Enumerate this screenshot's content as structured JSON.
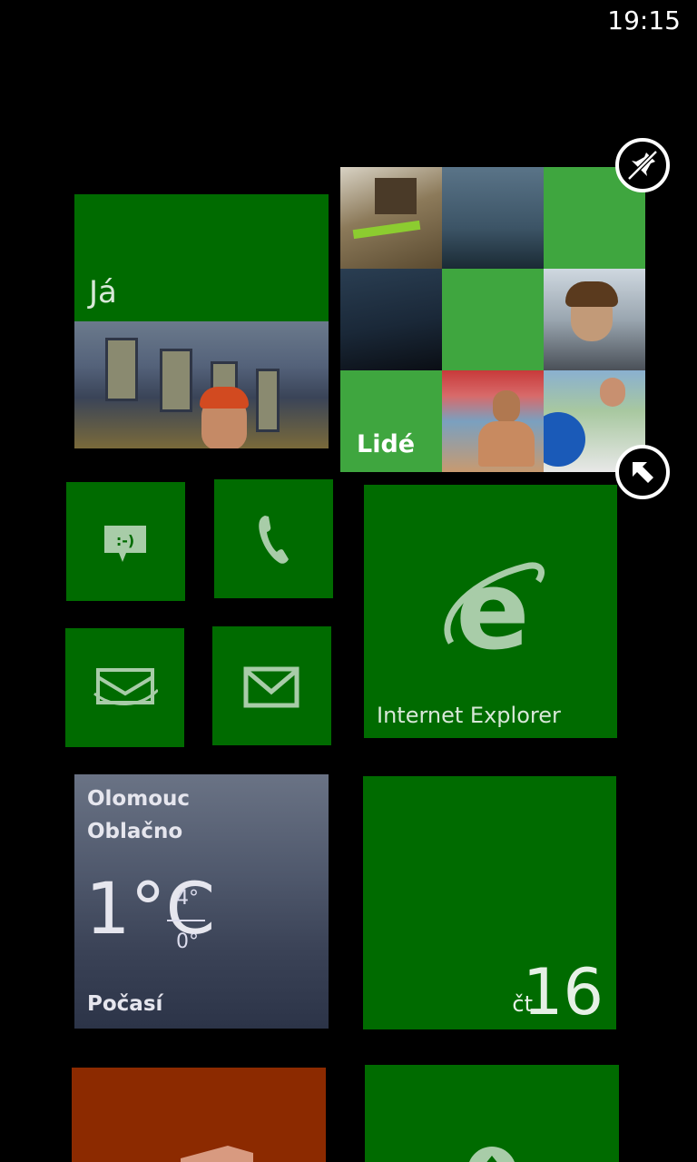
{
  "status_bar": {
    "time": "19:15"
  },
  "tiles": {
    "me": {
      "label": "Já"
    },
    "people": {
      "label": "Lidé"
    },
    "messaging": {
      "icon": "message-smiley-icon"
    },
    "phone": {
      "icon": "phone-icon"
    },
    "outlook": {
      "icon": "outlook-mail-icon"
    },
    "mail": {
      "icon": "mail-envelope-icon"
    },
    "internet_explorer": {
      "label": "Internet Explorer"
    },
    "weather": {
      "city": "Olomouc",
      "condition": "Oblačno",
      "temperature": "1°C",
      "high": "4°",
      "low": "0°",
      "label": "Počasí"
    },
    "calendar": {
      "day": "čt",
      "date": "16"
    },
    "office": {
      "icon": "office-icon"
    },
    "xbox": {
      "icon": "xbox-icon"
    }
  },
  "edit_controls": {
    "unpin_icon": "unpin-icon",
    "resize_icon": "resize-arrow-icon"
  },
  "colors": {
    "accent": "#006b00",
    "accent_light": "#3fa63f",
    "office": "#8c2a00",
    "background": "#000000"
  }
}
